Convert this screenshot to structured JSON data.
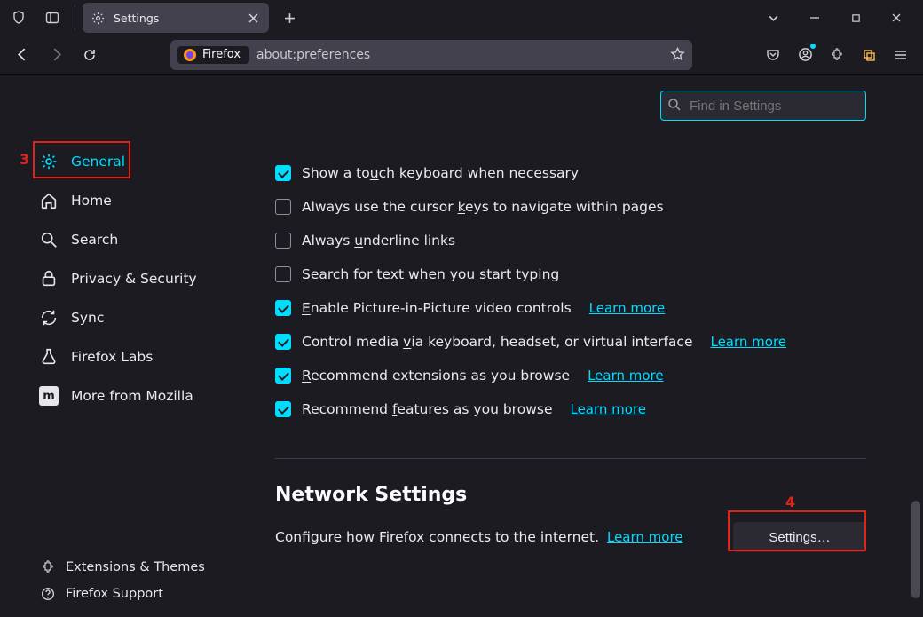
{
  "tab": {
    "title": "Settings"
  },
  "urlbar": {
    "brand": "Firefox",
    "address": "about:preferences"
  },
  "search": {
    "placeholder": "Find in Settings"
  },
  "sidebar": {
    "items": [
      {
        "label": "General",
        "active": true
      },
      {
        "label": "Home"
      },
      {
        "label": "Search"
      },
      {
        "label": "Privacy & Security"
      },
      {
        "label": "Sync"
      },
      {
        "label": "Firefox Labs"
      },
      {
        "label": "More from Mozilla"
      }
    ],
    "bottom": {
      "extensions": "Extensions & Themes",
      "support": "Firefox Support"
    }
  },
  "options": [
    {
      "checked": true,
      "pre": "Show a to",
      "u": "u",
      "post": "ch keyboard when necessary"
    },
    {
      "checked": false,
      "pre": "Always use the cursor ",
      "u": "k",
      "post": "eys to navigate within pages"
    },
    {
      "checked": false,
      "pre": "Always ",
      "u": "u",
      "post": "nderline links"
    },
    {
      "checked": false,
      "pre": "Search for te",
      "u": "x",
      "post": "t when you start typing"
    },
    {
      "checked": true,
      "pre": "",
      "u": "E",
      "post": "nable Picture-in-Picture video controls",
      "learn": "Learn more"
    },
    {
      "checked": true,
      "pre": "Control media ",
      "u": "v",
      "post": "ia keyboard, headset, or virtual interface",
      "learn": "Learn more"
    },
    {
      "checked": true,
      "pre": "",
      "u": "R",
      "post": "ecommend extensions as you browse",
      "learn": "Learn more"
    },
    {
      "checked": true,
      "pre": "Recommend ",
      "u": "f",
      "post": "eatures as you browse",
      "learn": "Learn more"
    }
  ],
  "network": {
    "title": "Network Settings",
    "desc": "Configure how Firefox connects to the internet.",
    "learn": "Learn more",
    "button": "Settings…"
  },
  "annot": {
    "n3": "3",
    "n4": "4"
  }
}
